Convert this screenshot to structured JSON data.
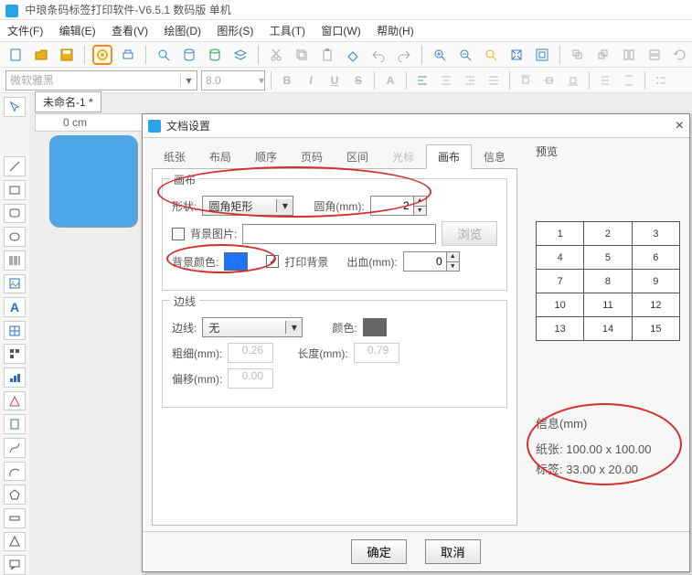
{
  "title": "中琅条码标签打印软件-V6.5.1 数码版 单机",
  "menus": [
    "文件(F)",
    "编辑(E)",
    "查看(V)",
    "绘图(D)",
    "图形(S)",
    "工具(T)",
    "窗口(W)",
    "帮助(H)"
  ],
  "font_name_placeholder": "微软雅黑",
  "font_size_placeholder": "8.0",
  "doc_tab": "未命名-1 *",
  "ruler0": "0 cm",
  "dialog": {
    "title": "文档设置",
    "tabs": [
      "纸张",
      "布局",
      "顺序",
      "页码",
      "区间",
      "光标",
      "画布",
      "信息"
    ],
    "active_tab_index": 6,
    "dim_tab_indices": [
      5
    ],
    "canvas_group": "画布",
    "shape_label": "形状:",
    "shape_value": "圆角矩形",
    "corner_label": "圆角(mm):",
    "corner_value": "2",
    "bgimg_label": "背景图片:",
    "bgimg_value": "",
    "browse": "浏览",
    "bgcolor_label": "背景颜色:",
    "bgcolor_hex": "#1e73ff",
    "printbg_label": "打印背景",
    "bleed_label": "出血(mm):",
    "bleed_value": "0",
    "border_group": "边线",
    "border_label": "边线:",
    "border_value": "无",
    "color_label": "颜色:",
    "color_hex": "#666666",
    "thick_label": "粗细(mm):",
    "thick_value": "0.26",
    "length_label": "长度(mm):",
    "length_value": "0.79",
    "offset_label": "偏移(mm):",
    "offset_value": "0.00",
    "preview": "预览",
    "grid_values": [
      "1",
      "2",
      "3",
      "4",
      "5",
      "6",
      "7",
      "8",
      "9",
      "10",
      "11",
      "12",
      "13",
      "14",
      "15"
    ],
    "info_title": "信息(mm)",
    "paper_label": "纸张:",
    "paper_value": "100.00 x 100.00",
    "labelsize_label": "标签:",
    "labelsize_value": "33.00 x 20.00",
    "ok": "确定",
    "cancel": "取消"
  }
}
